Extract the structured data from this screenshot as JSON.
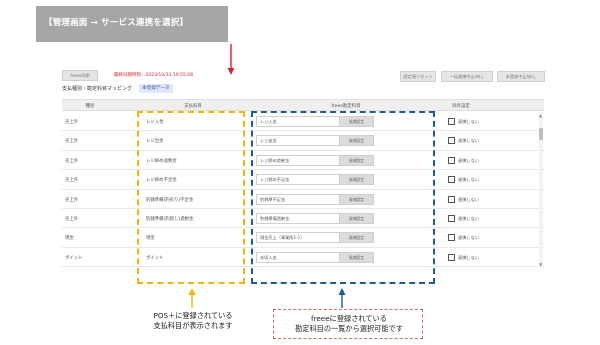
{
  "banner": {
    "text": "【管理画面 → サービス連携を選択】"
  },
  "toolbar": {
    "freee_sync": "freee同期",
    "last_sync": "最終同期時刻：2023/10/31 19:55:08",
    "reset": "設定値リセット",
    "bulk_enable": "一括連携中止/戻し",
    "unlinked_only": "未登録中止/戻し"
  },
  "mapping": {
    "title": "支払種別・勘定科目マッピング",
    "tag": "本登録データ"
  },
  "table": {
    "headers": {
      "type": "種別",
      "pos": "支払科目",
      "freee": "freee勘定科目",
      "exclude": "除外設定"
    },
    "freee_button": "候補設定",
    "exclude_label": "連携しない",
    "rows": [
      {
        "type": "売上外",
        "pos": "レジ入金",
        "freee": "レジ入金"
      },
      {
        "type": "売上外",
        "pos": "レジ出金",
        "freee": "レジ出金"
      },
      {
        "type": "売上外",
        "pos": "レジ締め過剰金",
        "freee": "レジ締め過剰金"
      },
      {
        "type": "売上外",
        "pos": "レジ締め不足金",
        "freee": "レジ締め不足金"
      },
      {
        "type": "売上外",
        "pos": "釣銭準備(釣有り)不足金",
        "freee": "釣銭準不足金"
      },
      {
        "type": "売上外",
        "pos": "釣銭準備(釣無し)過剰金",
        "freee": "釣銭準備過剰金"
      },
      {
        "type": "現金",
        "pos": "現金",
        "freee": "現金売上（事業所1-1）"
      },
      {
        "type": "ポイント",
        "pos": "ポイント",
        "freee": "未収入金"
      }
    ]
  },
  "annotations": {
    "left_line1": "POS＋に登録されている",
    "left_line2": "支払科目が表示されます",
    "right_line1": "freeeに登録されている",
    "right_line2": "勘定科目の一覧から選択可能です"
  },
  "colors": {
    "yellow": "#f5b400",
    "blue": "#1e5c96",
    "red": "#d9232f"
  },
  "icons": {
    "down_arrow": "down-arrow-icon",
    "up_arrow": "up-arrow-icon"
  }
}
